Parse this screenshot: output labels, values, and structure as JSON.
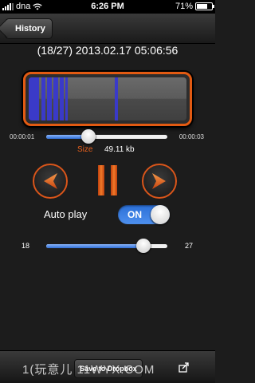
{
  "status_bar": {
    "carrier": "dna",
    "time": "6:26 PM",
    "battery": "71%",
    "battery_level": 0.71
  },
  "nav": {
    "back_label": "History"
  },
  "recording": {
    "title": "(18/27) 2013.02.17 05:06:56"
  },
  "waveform": {
    "highlight_color": "#3a3ac8",
    "frame_color": "#e25a12",
    "segments": [
      {
        "start": 0.0,
        "end": 0.065
      },
      {
        "start": 0.08,
        "end": 0.105
      },
      {
        "start": 0.118,
        "end": 0.145
      },
      {
        "start": 0.158,
        "end": 0.185
      },
      {
        "start": 0.198,
        "end": 0.222
      },
      {
        "start": 0.232,
        "end": 0.25
      },
      {
        "start": 0.545,
        "end": 0.565
      }
    ]
  },
  "playback": {
    "elapsed": "00:00:01",
    "total": "00:00:03",
    "progress": 0.35
  },
  "file": {
    "size_label": "Size",
    "size_value": "49.11  kb"
  },
  "controls": {
    "previous_icon": "chevron-left-icon",
    "pause_icon": "pause-icon",
    "next_icon": "chevron-right-icon",
    "accent_color": "#e8601c"
  },
  "autoplay": {
    "label": "Auto play",
    "state": "ON"
  },
  "range": {
    "min": "18",
    "max": "27",
    "current": 0.8
  },
  "toolbar": {
    "dropbox_label": "Save to Dropbox",
    "share_icon": "share-icon"
  },
  "watermark": "1(玩意儿 11WYX.COM"
}
